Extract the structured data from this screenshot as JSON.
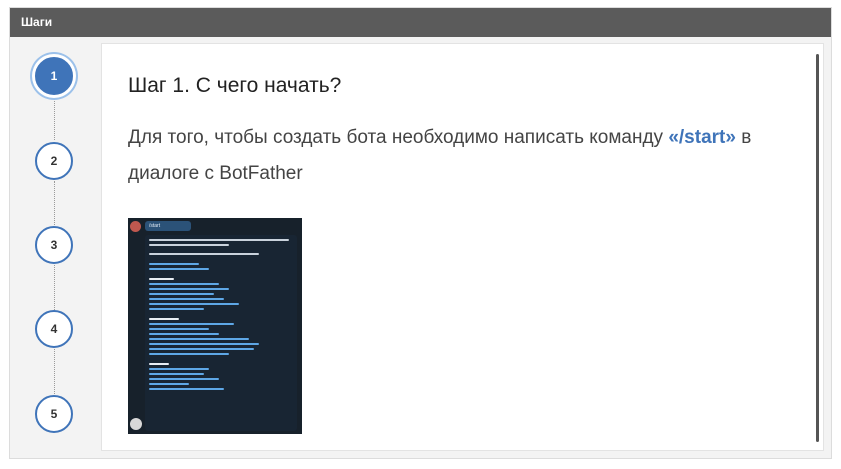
{
  "header": {
    "title": "Шаги"
  },
  "steps": [
    {
      "label": "1",
      "active": true
    },
    {
      "label": "2",
      "active": false
    },
    {
      "label": "3",
      "active": false
    },
    {
      "label": "4",
      "active": false
    },
    {
      "label": "5",
      "active": false
    }
  ],
  "content": {
    "title": "Шаг 1. С чего начать?",
    "text_before": "Для того, чтобы создать бота необходимо написать команду",
    "command": "«/start»",
    "text_after": " в диалоге с BotFather"
  },
  "screenshot": {
    "start_bubble": "/start"
  },
  "colors": {
    "accent": "#3f74b9",
    "header_bg": "#5b5b5b"
  }
}
